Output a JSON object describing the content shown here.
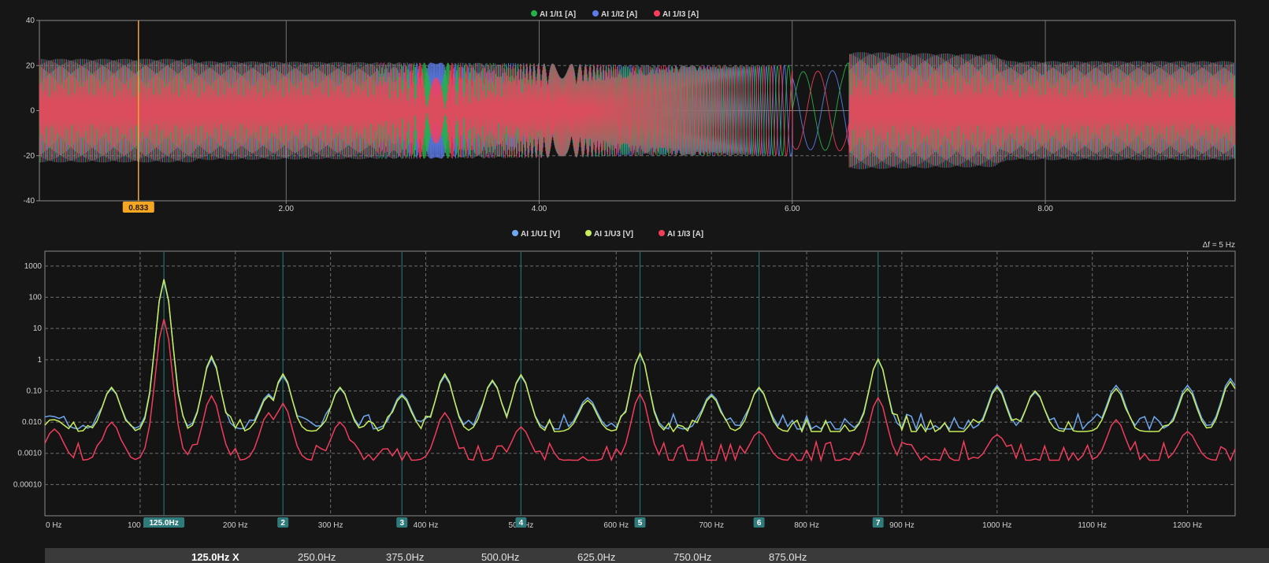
{
  "chart_data": [
    {
      "type": "line",
      "xlim": [
        0.05,
        9.5
      ],
      "ylim": [
        -40,
        40
      ],
      "x_ticks": [
        "2.00",
        "4.00",
        "6.00",
        "8.00"
      ],
      "x_tick_values": [
        2,
        4,
        6,
        8
      ],
      "y_ticks": [
        "40",
        "20",
        "0",
        "-20",
        "-40"
      ],
      "y_tick_values": [
        40,
        20,
        0,
        -20,
        -40
      ],
      "grid": true,
      "legend_position": "top-center",
      "series": [
        {
          "name": "AI 1/I1 [A]",
          "color": "#27b04a",
          "amplitude_x": [
            0.05,
            1.25,
            1.3,
            4.0,
            5.0,
            5.9,
            6.4,
            6.45,
            6.55,
            7.6,
            7.7,
            9.5
          ],
          "amplitude_y": [
            23,
            23,
            22,
            21,
            20,
            20,
            21,
            26,
            26,
            25,
            22,
            22
          ]
        },
        {
          "name": "AI 1/I2 [A]",
          "color": "#5b7be6",
          "amplitude_x": [
            0.05,
            1.25,
            1.3,
            4.0,
            5.0,
            5.9,
            6.4,
            6.45,
            6.55,
            7.6,
            7.7,
            9.5
          ],
          "amplitude_y": [
            23,
            23,
            22,
            21,
            20,
            20,
            21,
            26,
            26,
            25,
            22,
            22
          ]
        },
        {
          "name": "AI 1/I3 [A]",
          "color": "#fa3c5e",
          "amplitude_x": [
            0.05,
            1.25,
            1.3,
            4.0,
            5.0,
            5.9,
            6.4,
            6.45,
            6.55,
            7.6,
            7.7,
            9.5
          ],
          "amplitude_y": [
            23,
            23,
            22,
            21,
            20,
            20,
            21,
            26,
            26,
            25,
            22,
            22
          ]
        }
      ],
      "cursor": {
        "x": 0.833,
        "label": "0.833",
        "color": "#f5a623"
      }
    },
    {
      "type": "line",
      "log_y": true,
      "xlim": [
        0,
        1250
      ],
      "ylim": [
        1e-05,
        3000
      ],
      "x_ticks": [
        "0 Hz",
        "100 Hz",
        "200 Hz",
        "300 Hz",
        "400 Hz",
        "500 Hz",
        "600 Hz",
        "700 Hz",
        "800 Hz",
        "900 Hz",
        "1000 Hz",
        "1100 Hz",
        "1200 Hz"
      ],
      "x_tick_values": [
        0,
        100,
        200,
        300,
        400,
        500,
        600,
        700,
        800,
        900,
        1000,
        1100,
        1200
      ],
      "y_ticks": [
        "1000",
        "100",
        "10",
        "1",
        "0.10",
        "0.010",
        "0.0010",
        "0.00010"
      ],
      "y_tick_values": [
        1000,
        100,
        10,
        1,
        0.1,
        0.01,
        0.001,
        0.0001
      ],
      "grid": true,
      "legend_position": "top-center",
      "annotation": "Δf = 5 Hz",
      "freq_step": 5,
      "series": [
        {
          "name": "AI 1/U1 [V]",
          "color": "#6fa8f0",
          "peaks": [
            [
              10,
              0.015
            ],
            [
              70,
              0.12
            ],
            [
              125,
              350
            ],
            [
              175,
              1.1
            ],
            [
              235,
              0.08
            ],
            [
              250,
              0.3
            ],
            [
              310,
              0.12
            ],
            [
              375,
              0.08
            ],
            [
              420,
              0.3
            ],
            [
              470,
              0.2
            ],
            [
              500,
              0.3
            ],
            [
              570,
              0.06
            ],
            [
              625,
              1.5
            ],
            [
              700,
              0.08
            ],
            [
              750,
              0.12
            ],
            [
              875,
              1.0
            ],
            [
              1000,
              0.15
            ],
            [
              1040,
              0.09
            ],
            [
              1125,
              0.15
            ],
            [
              1200,
              0.15
            ],
            [
              1245,
              0.25
            ]
          ],
          "floor": 0.006,
          "noise": 0.5
        },
        {
          "name": "AI 1/U3 [V]",
          "color": "#c6ee5a",
          "peaks": [
            [
              10,
              0.012
            ],
            [
              70,
              0.13
            ],
            [
              125,
              380
            ],
            [
              175,
              1.3
            ],
            [
              235,
              0.07
            ],
            [
              250,
              0.35
            ],
            [
              310,
              0.13
            ],
            [
              375,
              0.07
            ],
            [
              420,
              0.35
            ],
            [
              470,
              0.22
            ],
            [
              500,
              0.33
            ],
            [
              570,
              0.05
            ],
            [
              625,
              1.6
            ],
            [
              700,
              0.07
            ],
            [
              750,
              0.13
            ],
            [
              875,
              1.05
            ],
            [
              1000,
              0.13
            ],
            [
              1040,
              0.1
            ],
            [
              1125,
              0.12
            ],
            [
              1200,
              0.12
            ],
            [
              1245,
              0.2
            ]
          ],
          "floor": 0.005,
          "noise": 0.55
        },
        {
          "name": "AI 1/I3 [A]",
          "color": "#f03d5c",
          "peaks": [
            [
              10,
              0.006
            ],
            [
              70,
              0.01
            ],
            [
              125,
              20
            ],
            [
              175,
              0.07
            ],
            [
              235,
              0.02
            ],
            [
              250,
              0.04
            ],
            [
              310,
              0.01
            ],
            [
              420,
              0.02
            ],
            [
              500,
              0.007
            ],
            [
              625,
              0.08
            ],
            [
              750,
              0.005
            ],
            [
              875,
              0.06
            ],
            [
              1000,
              0.004
            ],
            [
              1125,
              0.012
            ],
            [
              1200,
              0.005
            ]
          ],
          "floor": 0.0006,
          "noise": 0.6
        }
      ],
      "harmonic_markers": [
        {
          "freq": 125,
          "label": "125.0Hz"
        },
        {
          "freq": 250,
          "label": "2"
        },
        {
          "freq": 375,
          "label": "3"
        },
        {
          "freq": 500,
          "label": "4"
        },
        {
          "freq": 625,
          "label": "5"
        },
        {
          "freq": 750,
          "label": "6"
        },
        {
          "freq": 875,
          "label": "7"
        }
      ]
    }
  ],
  "harmonic_bar": {
    "labels": [
      "125.0Hz X",
      "250.0Hz",
      "375.0Hz",
      "500.0Hz",
      "625.0Hz",
      "750.0Hz",
      "875.0Hz"
    ]
  }
}
